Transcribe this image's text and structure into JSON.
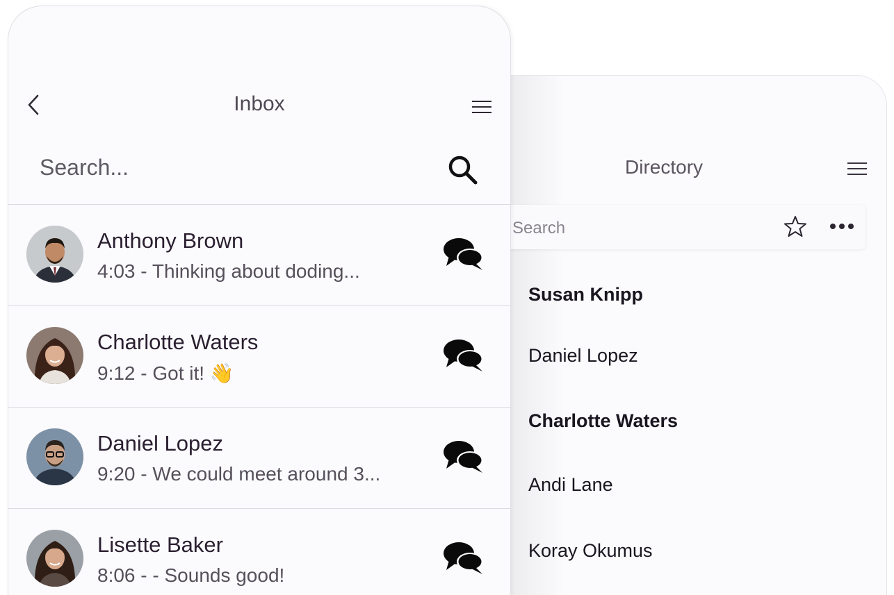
{
  "inbox": {
    "title": "Inbox",
    "search_placeholder": "Search...",
    "conversations": [
      {
        "name": "Anthony Brown",
        "time": "4:03",
        "preview": "Thinking about doding..."
      },
      {
        "name": "Charlotte Waters",
        "time": "9:12",
        "preview": "Got it! 👋"
      },
      {
        "name": "Daniel Lopez",
        "time": "9:20",
        "preview": "We could meet around 3..."
      },
      {
        "name": "Lisette Baker",
        "time": "8:06",
        "preview": "- Sounds good!"
      }
    ]
  },
  "directory": {
    "title": "Directory",
    "search_placeholder": "Search",
    "contacts": [
      {
        "name": "Susan Knipp",
        "bold": true
      },
      {
        "name": "Daniel Lopez",
        "bold": false
      },
      {
        "name": "Charlotte Waters",
        "bold": true
      },
      {
        "name": "Andi Lane",
        "bold": false
      },
      {
        "name": "Koray Okumus",
        "bold": false
      }
    ]
  },
  "icons": {
    "back": "chevron-left-icon",
    "menu": "hamburger-menu-icon",
    "search": "magnifier-icon",
    "favorite": "star-outline-icon",
    "more": "more-horizontal-icon",
    "chat": "chat-bubbles-icon"
  },
  "colors": {
    "card_background": "#fbfafc",
    "text_primary": "#2a1f30",
    "text_secondary": "#56505b",
    "divider": "#dcdadf"
  }
}
